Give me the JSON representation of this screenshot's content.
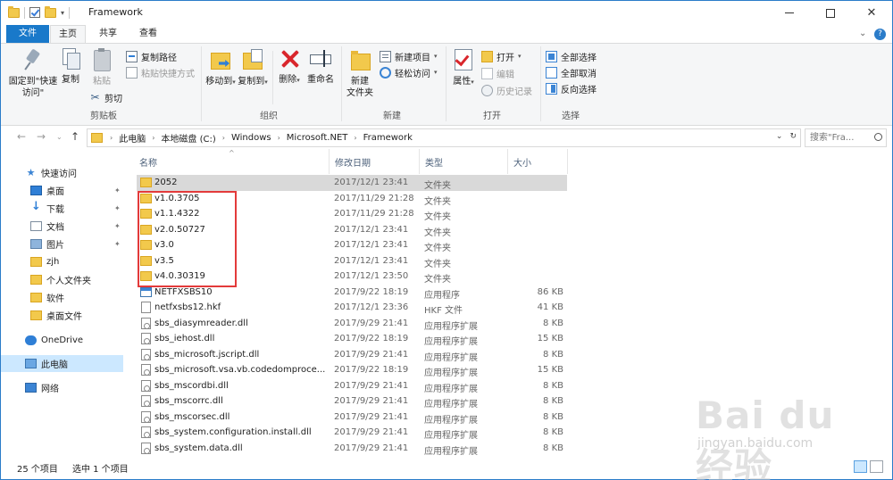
{
  "window": {
    "title": "Framework"
  },
  "tabs": {
    "file": "文件",
    "home": "主页",
    "share": "共享",
    "view": "查看"
  },
  "ribbon": {
    "clipboard": {
      "label": "剪贴板",
      "pin": "固定到\"快速访问\"",
      "copy": "复制",
      "paste": "粘贴",
      "copy_path": "复制路径",
      "paste_shortcut": "粘贴快捷方式",
      "cut": "剪切"
    },
    "organize": {
      "label": "组织",
      "move_to": "移动到",
      "copy_to": "复制到",
      "delete": "删除",
      "rename": "重命名"
    },
    "new": {
      "label": "新建",
      "new_folder": "新建\n文件夹",
      "new_item": "新建项目",
      "easy_access": "轻松访问"
    },
    "open": {
      "label": "打开",
      "properties": "属性",
      "open": "打开",
      "edit": "编辑",
      "history": "历史记录"
    },
    "select": {
      "label": "选择",
      "select_all": "全部选择",
      "select_none": "全部取消",
      "invert": "反向选择"
    }
  },
  "address": {
    "crumbs": [
      "此电脑",
      "本地磁盘 (C:)",
      "Windows",
      "Microsoft.NET",
      "Framework"
    ],
    "search_placeholder": "搜索\"Fra..."
  },
  "sidebar": {
    "quick_access": "快速访问",
    "items": [
      {
        "label": "桌面",
        "icon": "desktop-icon",
        "pinned": true
      },
      {
        "label": "下载",
        "icon": "download-icon",
        "pinned": true
      },
      {
        "label": "文档",
        "icon": "document-icon",
        "pinned": true
      },
      {
        "label": "图片",
        "icon": "picture-icon",
        "pinned": true
      },
      {
        "label": "zjh",
        "icon": "folder-icon",
        "pinned": false
      },
      {
        "label": "个人文件夹",
        "icon": "folder-icon",
        "pinned": false
      },
      {
        "label": "软件",
        "icon": "folder-icon",
        "pinned": false
      },
      {
        "label": "桌面文件",
        "icon": "folder-icon",
        "pinned": false
      }
    ],
    "onedrive": "OneDrive",
    "this_pc": "此电脑",
    "network": "网络"
  },
  "columns": {
    "name": "名称",
    "date": "修改日期",
    "type": "类型",
    "size": "大小"
  },
  "files": [
    {
      "name": "2052",
      "date": "2017/12/1 23:41",
      "type": "文件夹",
      "size": "",
      "kind": "folder"
    },
    {
      "name": "v1.0.3705",
      "date": "2017/11/29 21:28",
      "type": "文件夹",
      "size": "",
      "kind": "folder"
    },
    {
      "name": "v1.1.4322",
      "date": "2017/11/29 21:28",
      "type": "文件夹",
      "size": "",
      "kind": "folder"
    },
    {
      "name": "v2.0.50727",
      "date": "2017/12/1 23:41",
      "type": "文件夹",
      "size": "",
      "kind": "folder"
    },
    {
      "name": "v3.0",
      "date": "2017/12/1 23:41",
      "type": "文件夹",
      "size": "",
      "kind": "folder"
    },
    {
      "name": "v3.5",
      "date": "2017/12/1 23:41",
      "type": "文件夹",
      "size": "",
      "kind": "folder"
    },
    {
      "name": "v4.0.30319",
      "date": "2017/12/1 23:50",
      "type": "文件夹",
      "size": "",
      "kind": "folder"
    },
    {
      "name": "NETFXSBS10",
      "date": "2017/9/22 18:19",
      "type": "应用程序",
      "size": "86 KB",
      "kind": "exe"
    },
    {
      "name": "netfxsbs12.hkf",
      "date": "2017/12/1 23:36",
      "type": "HKF 文件",
      "size": "41 KB",
      "kind": "file"
    },
    {
      "name": "sbs_diasymreader.dll",
      "date": "2017/9/29 21:41",
      "type": "应用程序扩展",
      "size": "8 KB",
      "kind": "dll"
    },
    {
      "name": "sbs_iehost.dll",
      "date": "2017/9/22 18:19",
      "type": "应用程序扩展",
      "size": "15 KB",
      "kind": "dll"
    },
    {
      "name": "sbs_microsoft.jscript.dll",
      "date": "2017/9/29 21:41",
      "type": "应用程序扩展",
      "size": "8 KB",
      "kind": "dll"
    },
    {
      "name": "sbs_microsoft.vsa.vb.codedomproce...",
      "date": "2017/9/22 18:19",
      "type": "应用程序扩展",
      "size": "15 KB",
      "kind": "dll"
    },
    {
      "name": "sbs_mscordbi.dll",
      "date": "2017/9/29 21:41",
      "type": "应用程序扩展",
      "size": "8 KB",
      "kind": "dll"
    },
    {
      "name": "sbs_mscorrc.dll",
      "date": "2017/9/29 21:41",
      "type": "应用程序扩展",
      "size": "8 KB",
      "kind": "dll"
    },
    {
      "name": "sbs_mscorsec.dll",
      "date": "2017/9/29 21:41",
      "type": "应用程序扩展",
      "size": "8 KB",
      "kind": "dll"
    },
    {
      "name": "sbs_system.configuration.install.dll",
      "date": "2017/9/29 21:41",
      "type": "应用程序扩展",
      "size": "8 KB",
      "kind": "dll"
    },
    {
      "name": "sbs_system.data.dll",
      "date": "2017/9/29 21:41",
      "type": "应用程序扩展",
      "size": "8 KB",
      "kind": "dll"
    }
  ],
  "selected_row": 0,
  "status": {
    "count": "25 个项目",
    "selected": "选中 1 个项目"
  },
  "watermark": {
    "text": "Bai du 经验",
    "sub": "jingyan.baidu.com"
  }
}
